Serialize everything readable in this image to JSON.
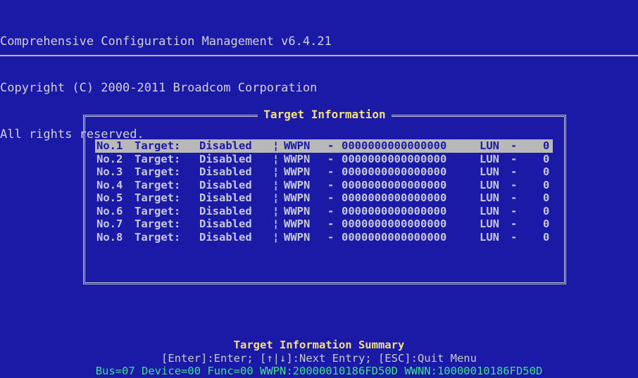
{
  "header": {
    "line1": "Comprehensive Configuration Management v6.4.21",
    "line2": "Copyright (C) 2000-2011 Broadcom Corporation",
    "line3": "All rights reserved."
  },
  "dialog": {
    "title": "Target Information",
    "rows": [
      {
        "num": "No.1",
        "target": "Target:",
        "status": "Disabled",
        "sep": "¦",
        "wwpn_label": "WWPN",
        "dash": "-",
        "wwpn": "0000000000000000",
        "lun_label": "LUN",
        "dash2": "-",
        "lun": "0",
        "selected": true
      },
      {
        "num": "No.2",
        "target": "Target:",
        "status": "Disabled",
        "sep": "¦",
        "wwpn_label": "WWPN",
        "dash": "-",
        "wwpn": "0000000000000000",
        "lun_label": "LUN",
        "dash2": "-",
        "lun": "0"
      },
      {
        "num": "No.3",
        "target": "Target:",
        "status": "Disabled",
        "sep": "¦",
        "wwpn_label": "WWPN",
        "dash": "-",
        "wwpn": "0000000000000000",
        "lun_label": "LUN",
        "dash2": "-",
        "lun": "0"
      },
      {
        "num": "No.4",
        "target": "Target:",
        "status": "Disabled",
        "sep": "¦",
        "wwpn_label": "WWPN",
        "dash": "-",
        "wwpn": "0000000000000000",
        "lun_label": "LUN",
        "dash2": "-",
        "lun": "0"
      },
      {
        "num": "No.5",
        "target": "Target:",
        "status": "Disabled",
        "sep": "¦",
        "wwpn_label": "WWPN",
        "dash": "-",
        "wwpn": "0000000000000000",
        "lun_label": "LUN",
        "dash2": "-",
        "lun": "0"
      },
      {
        "num": "No.6",
        "target": "Target:",
        "status": "Disabled",
        "sep": "¦",
        "wwpn_label": "WWPN",
        "dash": "-",
        "wwpn": "0000000000000000",
        "lun_label": "LUN",
        "dash2": "-",
        "lun": "0"
      },
      {
        "num": "No.7",
        "target": "Target:",
        "status": "Disabled",
        "sep": "¦",
        "wwpn_label": "WWPN",
        "dash": "-",
        "wwpn": "0000000000000000",
        "lun_label": "LUN",
        "dash2": "-",
        "lun": "0"
      },
      {
        "num": "No.8",
        "target": "Target:",
        "status": "Disabled",
        "sep": "¦",
        "wwpn_label": "WWPN",
        "dash": "-",
        "wwpn": "0000000000000000",
        "lun_label": "LUN",
        "dash2": "-",
        "lun": "0"
      }
    ]
  },
  "footer": {
    "summary_title": "Target Information Summary",
    "key_help": "[Enter]:Enter; [↑|↓]:Next Entry; [ESC]:Quit Menu",
    "device_info": "Bus=07 Device=00 Func=00 WWPN:20000010186FD50D WWNN:10000010186FD50D"
  },
  "colors": {
    "background": "#1a1aa6",
    "title_yellow": "#f5e17a",
    "status_green": "#3ee08a",
    "selection_bg": "#b8b8b8"
  }
}
